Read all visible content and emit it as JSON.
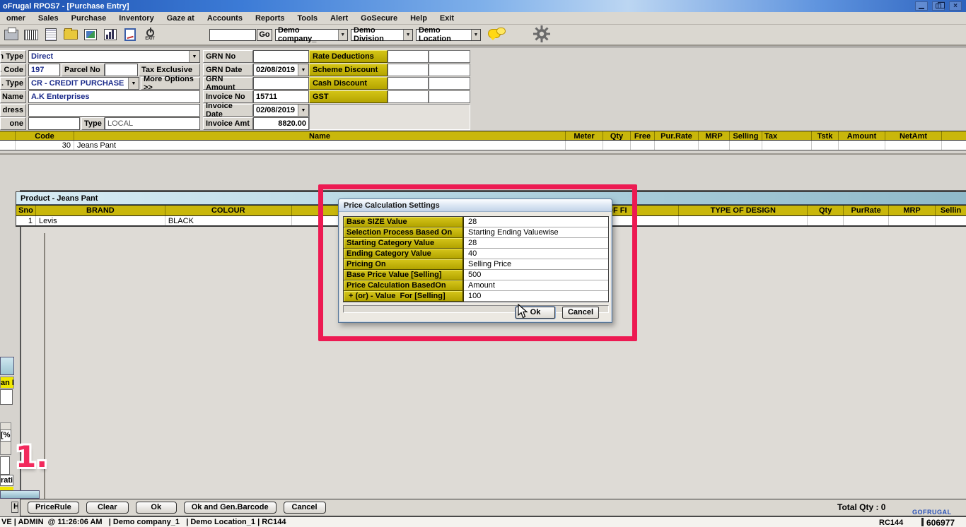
{
  "window": {
    "title": "oFrugal RPOS7 - [Purchase Entry]"
  },
  "menu": {
    "items": [
      "omer",
      "Sales",
      "Purchase",
      "Inventory",
      "Gaze at",
      "Accounts",
      "Reports",
      "Tools",
      "Alert",
      "GoSecure",
      "Help",
      "Exit"
    ]
  },
  "toolbar": {
    "go_label": "Go",
    "company": "Demo company_",
    "division": "Demo Division",
    "location": "Demo Location"
  },
  "form": {
    "trn_type_label": "n Type",
    "trn_type_value": "Direct",
    "code_label": "t. Code",
    "code_value": "197",
    "parcel_label": "Parcel No",
    "tax_label": "Tax Exclusive",
    "pur_type_label": ". Type",
    "pur_type_value": "CR - CREDIT PURCHASE",
    "more_options": "More Options >>",
    "name_label": "t Name",
    "name_value": "A.K Enterprises",
    "address_label": "dress",
    "phone_label": "one",
    "type_label": "Type",
    "type_value": "LOCAL",
    "grn_no_label": "GRN No",
    "grn_date_label": "GRN Date",
    "grn_date_value": "02/08/2019",
    "grn_amount_label": "GRN Amount",
    "invoice_no_label": "Invoice No",
    "invoice_no_value": "15711",
    "invoice_date_label": "Invoice Date",
    "invoice_date_value": "02/08/2019",
    "invoice_amt_label": "Invoice Amt",
    "invoice_amt_value": "8820.00"
  },
  "deductions": {
    "rows": [
      "Rate Deductions",
      "Scheme Discount",
      "Cash Discount",
      "GST"
    ]
  },
  "items_table": {
    "headers": {
      "code": "Code",
      "name": "Name",
      "meter": "Meter",
      "qty": "Qty",
      "free": "Free",
      "pur_rate": "Pur.Rate",
      "mrp": "MRP",
      "selling": "Selling",
      "tax": "Tax",
      "tstk": "Tstk",
      "amount": "Amount",
      "netamt": "NetAmt"
    },
    "row": {
      "code": "30",
      "name": "Jeans Pant"
    }
  },
  "product": {
    "title": "Product - Jeans Pant",
    "headers": {
      "sno": "Sno",
      "brand": "BRAND",
      "colour": "COLOUR",
      "of_fit": "OF FI",
      "type_of_design": "TYPE OF DESIGN",
      "qty": "Qty",
      "pur_rate": "PurRate",
      "mrp": "MRP",
      "selling": "Sellin"
    },
    "row": {
      "sno": "1",
      "brand": "Levis",
      "colour": "BLACK"
    }
  },
  "dialog": {
    "title": "Price Calculation Settings",
    "rows": [
      {
        "label": "Base SIZE Value",
        "value": "28"
      },
      {
        "label": "Selection Process Based On",
        "value": "Starting Ending Valuewise"
      },
      {
        "label": "Starting Category Value",
        "value": "28"
      },
      {
        "label": "Ending Category Value",
        "value": "40"
      },
      {
        "label": "Pricing On",
        "value": "Selling Price"
      },
      {
        "label": "Base Price Value [Selling]",
        "value": "500"
      },
      {
        "label": "Price Calculation BasedOn",
        "value": "Amount"
      },
      {
        "label": " + (or) - Value  For [Selling]",
        "value": "100"
      }
    ],
    "ok": "Ok",
    "cancel": "Cancel"
  },
  "annotation": {
    "step": "1."
  },
  "footer": {
    "buttons": {
      "price_rule": "PriceRule",
      "clear": "Clear",
      "ok": "Ok",
      "ok_gen": "Ok and Gen.Barcode",
      "cancel": "Cancel"
    },
    "total_qty": "Total Qty : 0",
    "fragment_h": "H"
  },
  "status": {
    "left": "VE | ADMIN  @ 11:26:06 AM   | Demo company_1   | Demo Location_1 | RC144",
    "rc": "RC144",
    "brand": "GOFRUGAL",
    "serial": "606977"
  },
  "fragments": {
    "scan": "an N",
    "percent": "[%",
    "rati": "rati"
  },
  "colors": {
    "annotation_red": "#ed1a52",
    "header_yellow": "#c9b70b",
    "bright_yellow": "#f0e800"
  }
}
